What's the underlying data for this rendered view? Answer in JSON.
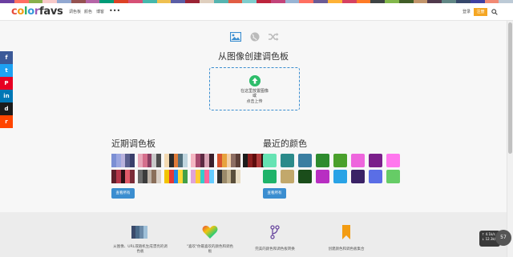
{
  "colorstrip": [
    "#6b3fa0",
    "#ff6f61",
    "#88b04b",
    "#f7cac9",
    "#92a8d1",
    "#955251",
    "#b565a7",
    "#009b77",
    "#dd4124",
    "#d65076",
    "#45b8ac",
    "#efc050",
    "#5b5ea6",
    "#9b2335",
    "#dfcfbe",
    "#55b4b0",
    "#e15d44",
    "#7fcdcd",
    "#bc243c",
    "#c3447a",
    "#98b4d4",
    "#ff6f61",
    "#6b5b95",
    "#feb236",
    "#d64161",
    "#ff7b25",
    "#3e4444",
    "#82b74b",
    "#405d27",
    "#c1946a",
    "#50394c",
    "#618685",
    "#36486b",
    "#4040a1",
    "#f18973",
    "#bccad6"
  ],
  "header": {
    "logo": [
      {
        "ch": "c",
        "color": "#e74c3c"
      },
      {
        "ch": "o",
        "color": "#f39c12"
      },
      {
        "ch": "l",
        "color": "#27ae60"
      },
      {
        "ch": "o",
        "color": "#3498db"
      },
      {
        "ch": "r",
        "color": "#9b59b6"
      },
      {
        "ch": "f",
        "color": "#333333"
      },
      {
        "ch": "a",
        "color": "#333333"
      },
      {
        "ch": "v",
        "color": "#333333"
      },
      {
        "ch": "s",
        "color": "#333333"
      }
    ],
    "nav": [
      "调色板",
      "颜色",
      "博客"
    ],
    "more": "•••",
    "login": "登录",
    "signup": "注册",
    "search_icon": "search-icon"
  },
  "hero": {
    "modes": [
      "image-icon",
      "globe-icon",
      "shuffle-icon"
    ],
    "mode_colors": [
      "#3b8ed0",
      "#bbbbbb",
      "#bbbbbb"
    ],
    "title": "从图像创建调色板",
    "dropzone": {
      "line1": "在这里放置图像",
      "line2": "或",
      "line3": "点击上传"
    }
  },
  "social": [
    {
      "icon": "facebook-icon",
      "glyph": "f",
      "color": "#3b5998"
    },
    {
      "icon": "twitter-icon",
      "glyph": "t",
      "color": "#1da1f2"
    },
    {
      "icon": "pinterest-icon",
      "glyph": "P",
      "color": "#e60023"
    },
    {
      "icon": "linkedin-icon",
      "glyph": "in",
      "color": "#0077b5"
    },
    {
      "icon": "digg-icon",
      "glyph": "d",
      "color": "#1b1b1b"
    },
    {
      "icon": "reddit-icon",
      "glyph": "r",
      "color": "#ff4500"
    }
  ],
  "recent_palettes": {
    "title": "近期调色板",
    "button": "查看所有",
    "palettes": [
      [
        "#7b8fd4",
        "#9ba6e0",
        "#b9b2dd",
        "#5a5f8f",
        "#3a3f6b"
      ],
      [
        "#e8a6b8",
        "#d56f8c",
        "#8a3f62",
        "#c8c8c8",
        "#4d4d4d"
      ],
      [
        "#f3d9b1",
        "#2b2b2b",
        "#e07b39",
        "#4f6d7a",
        "#c0d6df"
      ],
      [
        "#f4b6c2",
        "#a84b6e",
        "#5c2a42",
        "#d9a3b5",
        "#3b1f2b"
      ],
      [
        "#d8542f",
        "#e7a33e",
        "#f2d0a9",
        "#8d6e63",
        "#5d4037"
      ],
      [
        "#1c1c1c",
        "#8b1e1e",
        "#5c0d0d",
        "#b23a3a",
        "#2b1111"
      ],
      [
        "#5e1f2b",
        "#b5364a",
        "#2c0f15",
        "#e05a6a",
        "#7a2b38"
      ],
      [
        "#6b6b6b",
        "#3b3b3b",
        "#bdb2a7",
        "#8a6f5a",
        "#d9cfc5"
      ],
      [
        "#f2c400",
        "#e53935",
        "#1e88e5",
        "#fdd835",
        "#43a047"
      ],
      [
        "#e0a3d8",
        "#ffcc33",
        "#33cccc",
        "#ff6699",
        "#66ccff"
      ],
      [
        "#2f2f2f",
        "#9b8a6a",
        "#c2b28f",
        "#5a4e3a",
        "#e8dcc2"
      ]
    ]
  },
  "recent_colors": {
    "title": "最近的颜色",
    "button": "查看所有",
    "colors": [
      "#66e3b3",
      "#2b8a8a",
      "#3a7ea1",
      "#2e8b2e",
      "#4aa02c",
      "#ee66dd",
      "#7a1f8a",
      "#ff77ee",
      "#1fb36a",
      "#c2a86b",
      "#1a4d1a",
      "#b82ec2",
      "#29a3e6",
      "#3a2266",
      "#5a6ee6",
      "#66cc66"
    ]
  },
  "features": [
    {
      "icon": "palette-stack-icon",
      "text": "从图像、URL或随机生成漂亮的调色板"
    },
    {
      "icon": "heart-icon",
      "text": "\"喜欢\"你最喜欢的颜色和调色板"
    },
    {
      "icon": "fork-icon",
      "text": "完美的颜色和调色板转换"
    },
    {
      "icon": "bookmark-icon",
      "text": "创建颜色和调色板集合"
    }
  ],
  "widget": {
    "up": "↑ 4.1k/s",
    "down": "↓ 12.3k/s",
    "gauge": "57"
  }
}
